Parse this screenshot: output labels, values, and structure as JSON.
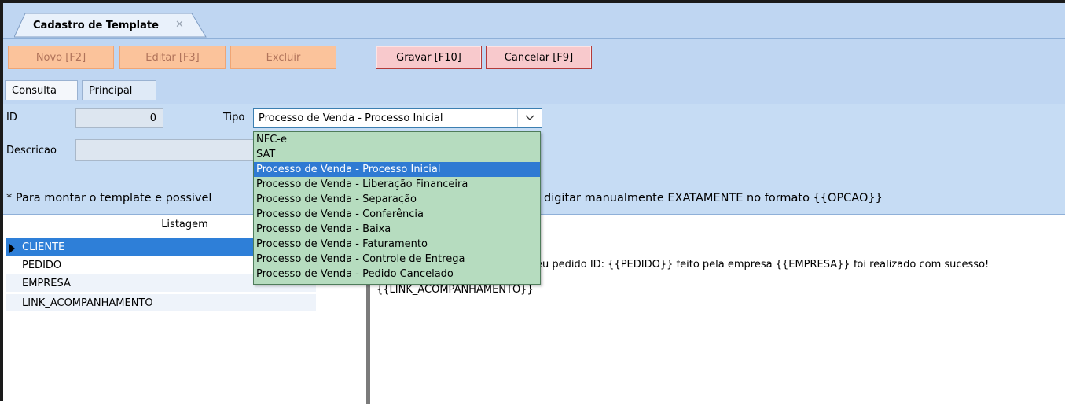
{
  "window": {
    "doc_tab_title": "Cadastro de Template",
    "doc_tab_close": "✕"
  },
  "toolbar": {
    "novo": "Novo [F2]",
    "editar": "Editar [F3]",
    "excluir": "Excluir",
    "gravar": "Gravar [F10]",
    "cancelar": "Cancelar [F9]"
  },
  "tabs": {
    "consulta": "Consulta",
    "principal": "Principal"
  },
  "form": {
    "id_label": "ID",
    "id_value": "0",
    "tipo_label": "Tipo",
    "tipo_value": "Processo de Venda - Processo Inicial",
    "descricao_label": "Descricao",
    "descricao_value": "",
    "hint_left": "* Para montar o template e possivel",
    "hint_right": "digitar manualmente EXATAMENTE no formato {{OPCAO}}"
  },
  "dropdown": {
    "options": [
      "NFC-e",
      "SAT",
      "Processo de Venda - Processo Inicial",
      "Processo de Venda - Liberação Financeira",
      "Processo de Venda - Separação",
      "Processo de Venda - Conferência",
      "Processo de Venda - Baixa",
      "Processo de Venda - Faturamento",
      "Processo de Venda - Controle de Entrega",
      "Processo de Venda - Pedido Cancelado"
    ],
    "selected_index": 2
  },
  "listagem": {
    "header": "Listagem",
    "items": [
      "CLIENTE",
      "PEDIDO",
      "EMPRESA",
      "LINK_ACOMPANHAMENTO"
    ],
    "selected_index": 0
  },
  "template_text": {
    "line1": "eu pedido ID: {{PEDIDO}} feito pela empresa {{EMPRESA}} foi realizado com sucesso!",
    "line2": "{{LINK_ACOMPANHAMENTO}}"
  },
  "colors": {
    "panel_blue": "#c6dcf4",
    "selection_blue": "#2f7ad3",
    "dropdown_green": "#b6dcbf",
    "disabled_button": "#fbc39b",
    "enabled_button": "#f8c9cc"
  }
}
